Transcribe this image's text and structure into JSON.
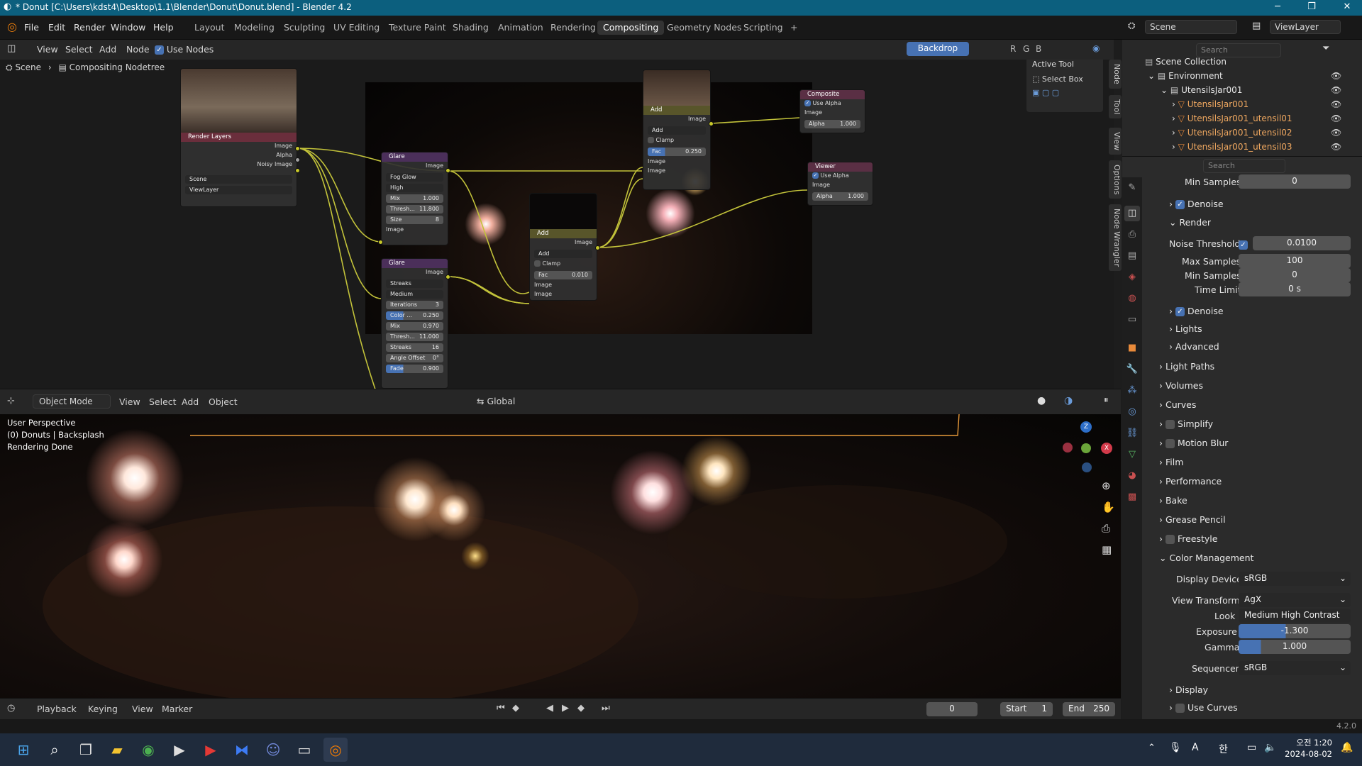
{
  "window": {
    "title": "* Donut [C:\\Users\\kdst4\\Desktop\\1.1\\Blender\\Donut\\Donut.blend] - Blender 4.2",
    "minimize": "─",
    "maximize": "❐",
    "close": "✕"
  },
  "menu": [
    "File",
    "Edit",
    "Render",
    "Window",
    "Help"
  ],
  "workspaces": [
    "Layout",
    "Modeling",
    "Sculpting",
    "UV Editing",
    "Texture Paint",
    "Shading",
    "Animation",
    "Rendering",
    "Compositing",
    "Geometry Nodes",
    "Scripting",
    "+"
  ],
  "active_workspace": "Compositing",
  "top_right": {
    "scene": "Scene",
    "view_layer": "ViewLayer"
  },
  "node_editor": {
    "menus": [
      "View",
      "Select",
      "Add",
      "Node"
    ],
    "use_nodes": "Use Nodes",
    "backdrop": "Backdrop",
    "channels": [
      "R",
      "G",
      "B"
    ],
    "breadcrumb": [
      "Scene",
      "Compositing Nodetree"
    ],
    "active_tool": {
      "title": "Active Tool",
      "tool": "Select Box"
    },
    "side_tabs": [
      "Node",
      "Tool",
      "View",
      "Options",
      "Node Wrangler"
    ],
    "nodes": {
      "render_layers": {
        "title": "Render Layers",
        "outputs": [
          "Image",
          "Alpha",
          "Noisy Image"
        ],
        "scene": "Scene",
        "layer": "ViewLayer"
      },
      "glare1": {
        "title": "Glare",
        "out": "Image",
        "type": "Fog Glow",
        "quality": "High",
        "mix_label": "Mix",
        "mix": "1.000",
        "thresh_label": "Thresh...",
        "thresh": "11.800",
        "size_label": "Size",
        "size": "8",
        "in": "Image"
      },
      "glare2": {
        "title": "Glare",
        "out": "Image",
        "type": "Streaks",
        "quality": "Medium",
        "iter_label": "Iterations",
        "iter": "3",
        "color_label": "Color ...",
        "color": "0.250",
        "mix_label": "Mix",
        "mix": "0.970",
        "thresh_label": "Thresh...",
        "thresh": "11.000",
        "streaks_label": "Streaks",
        "streaks": "16",
        "angle_label": "Angle Offset",
        "angle": "0°",
        "fade_label": "Fade",
        "fade": "0.900"
      },
      "add1": {
        "title": "Add",
        "out": "Image",
        "op": "Add",
        "clamp": "Clamp",
        "fac_label": "Fac",
        "fac": "0.250",
        "in1": "Image",
        "in2": "Image"
      },
      "add2": {
        "title": "Add",
        "out": "Image",
        "op": "Add",
        "clamp": "Clamp",
        "fac_label": "Fac",
        "fac": "0.010",
        "in1": "Image",
        "in2": "Image"
      },
      "composite": {
        "title": "Composite",
        "use_alpha": "Use Alpha",
        "in": "Image",
        "alpha_label": "Alpha",
        "alpha": "1.000"
      },
      "viewer": {
        "title": "Viewer",
        "use_alpha": "Use Alpha",
        "in": "Image",
        "alpha_label": "Alpha",
        "alpha": "1.000"
      }
    }
  },
  "viewport": {
    "mode": "Object Mode",
    "menus": [
      "View",
      "Select",
      "Add",
      "Object"
    ],
    "transform": "Global",
    "overlay_lines": [
      "User Perspective",
      "(0) Donuts | Backsplash",
      "Rendering Done"
    ],
    "gizmo": {
      "z": "Z",
      "x": "X"
    }
  },
  "timeline": {
    "menus": [
      "Playback",
      "Keying",
      "View",
      "Marker"
    ],
    "current_frame": "0",
    "start_label": "Start",
    "start": "1",
    "end_label": "End",
    "end": "250"
  },
  "status": {
    "version": "4.2.0"
  },
  "outliner": {
    "search_placeholder": "Search",
    "items": [
      {
        "label": "Scene Collection",
        "indent": 0
      },
      {
        "label": "Environment",
        "indent": 1
      },
      {
        "label": "UtensilsJar001",
        "indent": 2
      },
      {
        "label": "UtensilsJar001",
        "indent": 3
      },
      {
        "label": "UtensilsJar001_utensil01",
        "indent": 3
      },
      {
        "label": "UtensilsJar001_utensil02",
        "indent": 3
      },
      {
        "label": "UtensilsJar001_utensil03",
        "indent": 3
      }
    ]
  },
  "properties": {
    "search_placeholder": "Search",
    "min_samples_top_label": "Min Samples",
    "min_samples_top": "0",
    "denoise1": "Denoise",
    "render_section": "Render",
    "noise_threshold_label": "Noise Threshold",
    "noise_threshold": "0.0100",
    "max_samples_label": "Max Samples",
    "max_samples": "100",
    "min_samples_label": "Min Samples",
    "min_samples": "0",
    "time_limit_label": "Time Limit",
    "time_limit": "0 s",
    "denoise2": "Denoise",
    "lights": "Lights",
    "advanced": "Advanced",
    "sections": [
      "Light Paths",
      "Volumes",
      "Curves",
      "Simplify",
      "Motion Blur",
      "Film",
      "Performance",
      "Bake",
      "Grease Pencil",
      "Freestyle"
    ],
    "color_management": "Color Management",
    "display_device_label": "Display Device",
    "display_device": "sRGB",
    "view_transform_label": "View Transform",
    "view_transform": "AgX",
    "look_label": "Look",
    "look": "Medium High Contrast",
    "exposure_label": "Exposure",
    "exposure": "-1.300",
    "gamma_label": "Gamma",
    "gamma": "1.000",
    "sequencer_label": "Sequencer",
    "sequencer": "sRGB",
    "display": "Display",
    "use_curves": "Use Curves"
  },
  "taskbar": {
    "time": "오전 1:20",
    "date": "2024-08-02",
    "ime": "A",
    "ime2": "한"
  }
}
